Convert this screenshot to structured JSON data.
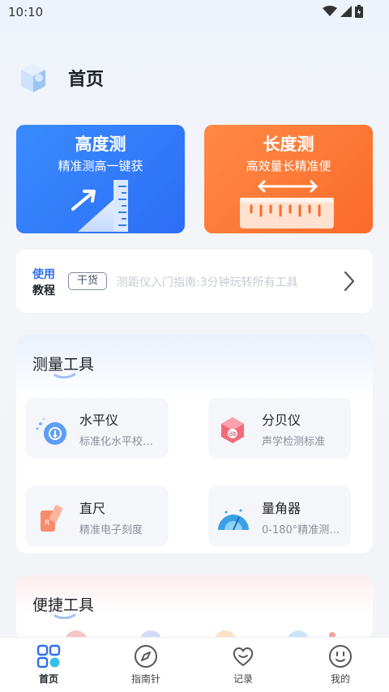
{
  "status": {
    "time": "10:10"
  },
  "header": {
    "title": "首页"
  },
  "cards": [
    {
      "title": "高度测",
      "subtitle": "精准测高一键获"
    },
    {
      "title": "长度测",
      "subtitle": "高效量长精准便"
    }
  ],
  "tutorial": {
    "label_line1": "使用",
    "label_line2": "教程",
    "badge": "干货",
    "text": "测距仪入门指南:3分钟玩转所有工具"
  },
  "measure_tools": {
    "title": "测量工具",
    "items": [
      {
        "name": "水平仪",
        "desc": "标准化水平校…"
      },
      {
        "name": "分贝仪",
        "desc": "声学检测标准"
      },
      {
        "name": "直尺",
        "desc": "精准电子刻度"
      },
      {
        "name": "量角器",
        "desc": "0-180°精准测…"
      }
    ]
  },
  "quick_tools": {
    "title": "便捷工具"
  },
  "nav": [
    {
      "label": "首页",
      "active": true
    },
    {
      "label": "指南针",
      "active": false
    },
    {
      "label": "记录",
      "active": false
    },
    {
      "label": "我的",
      "active": false
    }
  ],
  "colors": {
    "accent_blue": "#2c6ef5",
    "accent_orange": "#fb6a2a"
  }
}
